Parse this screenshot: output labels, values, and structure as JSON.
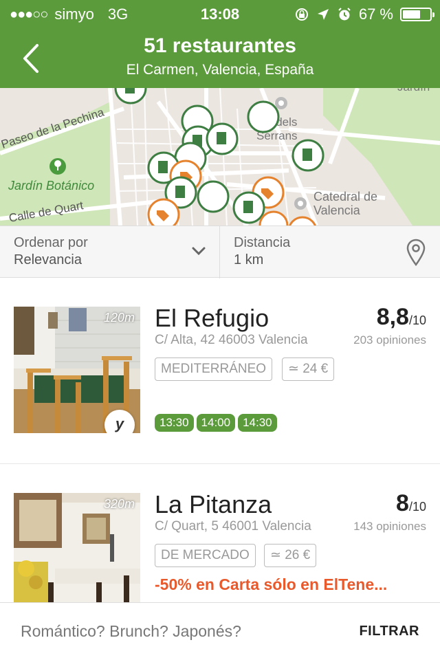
{
  "status": {
    "signal_dots": "●●●○○",
    "carrier": "simyo",
    "network": "3G",
    "time": "13:08",
    "battery_text": "67 %",
    "battery_level": 0.67
  },
  "header": {
    "title": "51 restaurantes",
    "subtitle": "El Carmen, Valencia, España"
  },
  "map": {
    "labels": {
      "paseo": "Paseo de la Pechina",
      "jardin": "Jardín Botánico",
      "quart": "Calle de Quart",
      "serrans_a": "s dels",
      "serrans_b": "Serrans",
      "catedral_a": "Catedral de",
      "catedral_b": "Valencia",
      "jardin_top": "Jardín"
    }
  },
  "filters": {
    "sort_label": "Ordenar por",
    "sort_value": "Relevancia",
    "distance_label": "Distancia",
    "distance_value": "1 km"
  },
  "restaurants": [
    {
      "distance": "120m",
      "name": "El Refugio",
      "address": "C/ Alta, 42 46003 Valencia",
      "score": "8,8",
      "score_max": "/10",
      "reviews": "203 opiniones",
      "cuisine": "MEDITERRÁNEO",
      "price": "≃ 24 €",
      "badge": "y",
      "slots": [
        "13:30",
        "14:00",
        "14:30"
      ]
    },
    {
      "distance": "320m",
      "name": "La Pitanza",
      "address": "C/ Quart, 5 46001 Valencia",
      "score": "8",
      "score_max": "/10",
      "reviews": "143 opiniones",
      "cuisine": "DE MERCADO",
      "price": "≃ 26 €",
      "promo": "-50% en Carta sólo en ElTene..."
    }
  ],
  "bottom": {
    "placeholder": "Romántico? Brunch? Japonés?",
    "filter_button": "FILTRAR"
  },
  "colors": {
    "brand_green": "#5c9b3c",
    "promo_orange": "#e85a2c"
  }
}
